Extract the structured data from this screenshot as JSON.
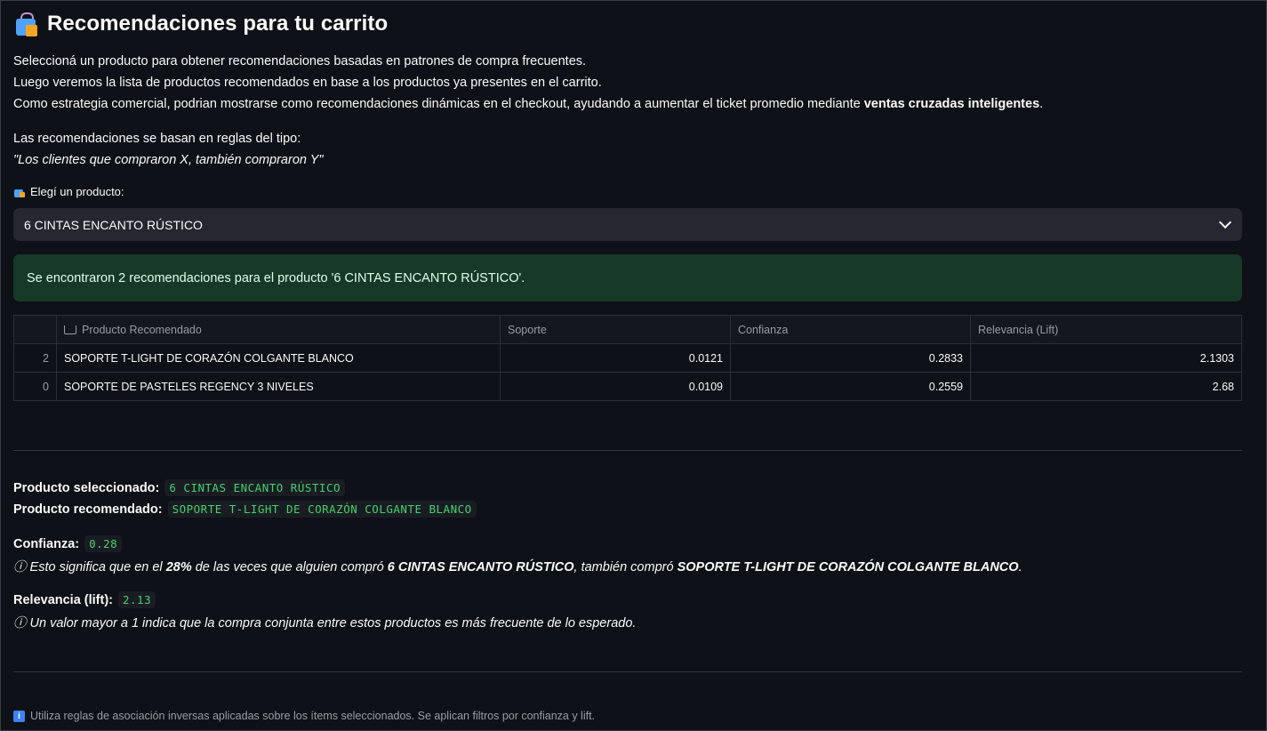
{
  "header": {
    "title": "Recomendaciones para tu carrito",
    "icon": "shopping-bags-icon"
  },
  "intro": {
    "line1": "Seleccioná un producto para obtener recomendaciones basadas en patrones de compra frecuentes.",
    "line2": "Luego veremos la lista de productos recomendados en base a los productos ya presentes en el carrito.",
    "line3_pre": "Como estrategia comercial, podrian mostrarse como recomendaciones dinámicas en el checkout, ayudando a aumentar el ticket promedio mediante ",
    "line3_bold": "ventas cruzadas inteligentes",
    "line3_post": ".",
    "rules_line": "Las recomendaciones se basan en reglas del tipo:",
    "rules_example": "\"Los clientes que compraron X, también compraron Y\""
  },
  "selector": {
    "label": "Elegí un producto:",
    "value": "6 CINTAS ENCANTO RÚSTICO"
  },
  "success_message": "Se encontraron 2 recomendaciones para el producto '6 CINTAS ENCANTO RÚSTICO'.",
  "table": {
    "headers": [
      "",
      "Producto Recomendado",
      "Soporte",
      "Confianza",
      "Relevancia (Lift)"
    ],
    "rows": [
      {
        "index": "2",
        "producto": "SOPORTE T-LIGHT DE CORAZÓN COLGANTE BLANCO",
        "soporte": "0.0121",
        "confianza": "0.2833",
        "lift": "2.1303"
      },
      {
        "index": "0",
        "producto": "SOPORTE DE PASTELES REGENCY 3 NIVELES",
        "soporte": "0.0109",
        "confianza": "0.2559",
        "lift": "2.68"
      }
    ]
  },
  "details": {
    "selected_label": "Producto seleccionado:",
    "selected_value": "6 CINTAS ENCANTO RÚSTICO",
    "recommended_label": "Producto recomendado:",
    "recommended_value": "SOPORTE T-LIGHT DE CORAZÓN COLGANTE BLANCO",
    "confidence_label": "Confianza:",
    "confidence_value": "0.28",
    "confidence_note_1": "ⓘ Esto significa que en el ",
    "confidence_note_pct": "28%",
    "confidence_note_2": " de las veces que alguien compró ",
    "confidence_note_prod1": "6 CINTAS ENCANTO RÚSTICO",
    "confidence_note_3": ", también compró ",
    "confidence_note_prod2": "SOPORTE T-LIGHT DE CORAZÓN COLGANTE BLANCO",
    "confidence_note_4": ".",
    "lift_label": "Relevancia (lift):",
    "lift_value": "2.13",
    "lift_note": "ⓘ Un valor mayor a 1 indica que la compra conjunta entre estos productos es más frecuente de lo esperado."
  },
  "footer": {
    "info_text": "Utiliza reglas de asociación inversas aplicadas sobre los ítems seleccionados. Se aplican filtros por confianza y lift."
  },
  "colors": {
    "background": "#0e1117",
    "success_bg": "#173928",
    "code_green": "#3dd56d"
  }
}
